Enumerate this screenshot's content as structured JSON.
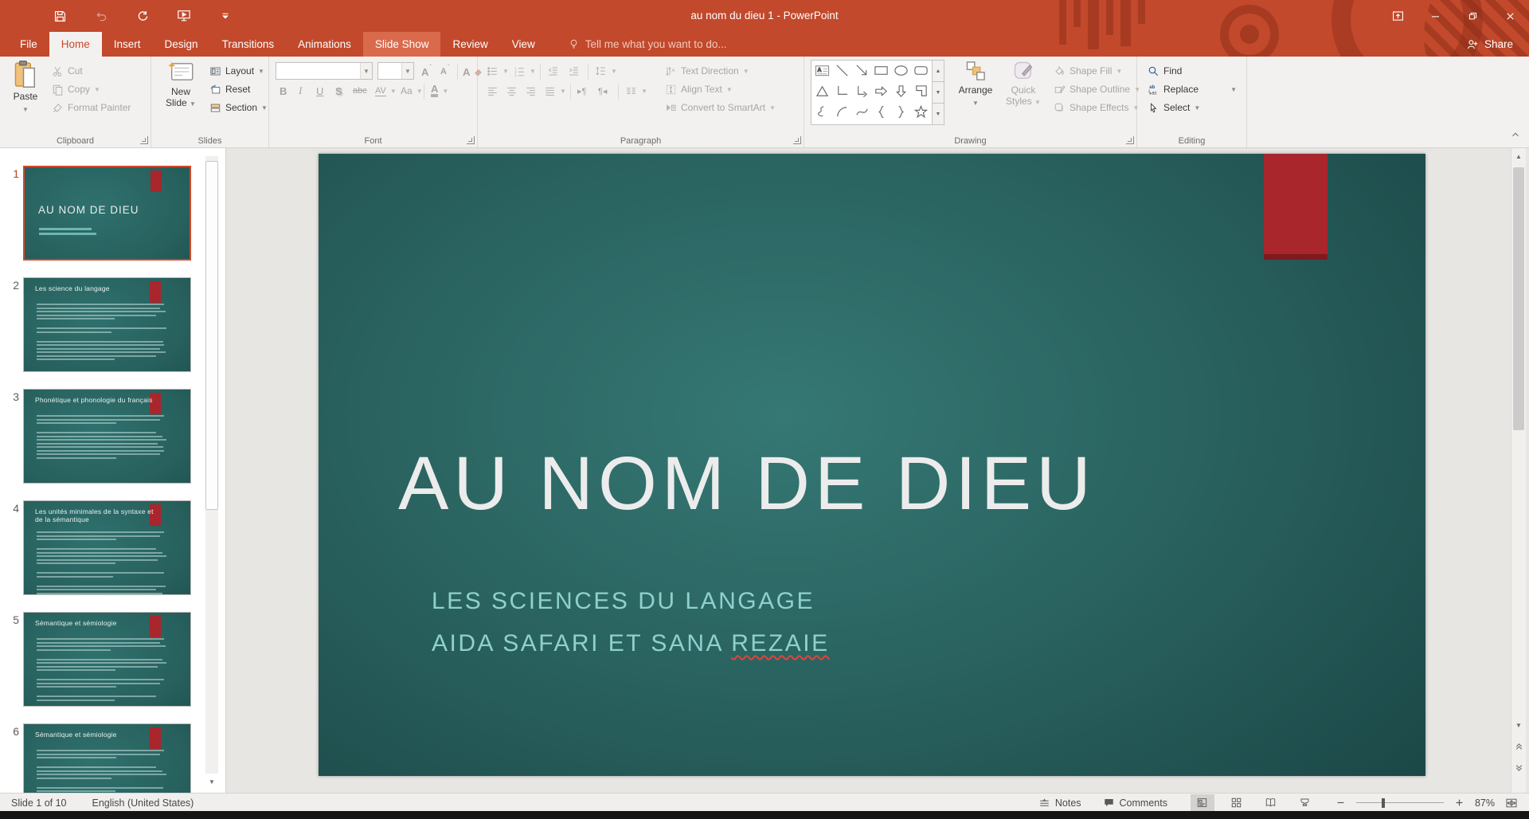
{
  "colors": {
    "accent_red": "#C2492C",
    "tab_highlight": "#D96A4C",
    "slide_teal_center": "#357874",
    "slide_teal_edge": "#153E3E",
    "slide_accent_red": "#A8262C",
    "subtitle_teal": "#8ED1CD"
  },
  "titlebar": {
    "title": "au nom du dieu 1 - PowerPoint"
  },
  "tabs": [
    {
      "label": "File",
      "state": "file"
    },
    {
      "label": "Home",
      "state": "sel"
    },
    {
      "label": "Insert",
      "state": ""
    },
    {
      "label": "Design",
      "state": ""
    },
    {
      "label": "Transitions",
      "state": ""
    },
    {
      "label": "Animations",
      "state": ""
    },
    {
      "label": "Slide Show",
      "state": "hl"
    },
    {
      "label": "Review",
      "state": ""
    },
    {
      "label": "View",
      "state": ""
    }
  ],
  "tellme": {
    "label": "Tell me what you want to do..."
  },
  "share": {
    "label": "Share"
  },
  "ribbon": {
    "clipboard": {
      "label": "Clipboard",
      "paste": "Paste",
      "cut": "Cut",
      "copy": "Copy",
      "format_painter": "Format Painter"
    },
    "slides": {
      "label": "Slides",
      "new_slide_line1": "New",
      "new_slide_line2": "Slide",
      "layout": "Layout",
      "reset": "Reset",
      "section": "Section"
    },
    "font": {
      "label": "Font",
      "bold": "B",
      "italic": "I",
      "underline": "U",
      "shadow": "S",
      "strike": "abc",
      "spacing": "AV",
      "case": "Aa",
      "color": "A",
      "grow": "A",
      "shrink": "A",
      "clear": "A"
    },
    "paragraph": {
      "label": "Paragraph",
      "text_direction": "Text Direction",
      "align_text": "Align Text",
      "convert_smartart": "Convert to SmartArt"
    },
    "drawing": {
      "label": "Drawing",
      "arrange": "Arrange",
      "quick_line1": "Quick",
      "quick_line2": "Styles",
      "shape_fill": "Shape Fill",
      "shape_outline": "Shape Outline",
      "shape_effects": "Shape Effects"
    },
    "editing": {
      "label": "Editing",
      "find": "Find",
      "replace": "Replace",
      "select": "Select"
    }
  },
  "shape_gallery": [
    "textbox",
    "line",
    "arrow",
    "rect",
    "oval",
    "roundrect",
    "triangle",
    "elbow",
    "elbowarrow",
    "arrowright",
    "arrowdown",
    "corner",
    "scribble",
    "arc",
    "curve",
    "braceleft",
    "braceright",
    "star"
  ],
  "thumbnails": [
    {
      "number": "1",
      "type": "title",
      "title": "AU NOM DE DIEU",
      "selected": true,
      "sub_lines": [
        66,
        72
      ],
      "blocks": []
    },
    {
      "number": "2",
      "type": "content",
      "title": "Les science du langage",
      "selected": false,
      "blocks": [
        5,
        2,
        6
      ]
    },
    {
      "number": "3",
      "type": "content",
      "title": "Phonétique et phonologie du français",
      "selected": false,
      "blocks": [
        3,
        8
      ]
    },
    {
      "number": "4",
      "type": "content",
      "title": "Les unités minimales de la syntaxe et de la sémantique",
      "selected": false,
      "blocks": [
        3,
        5,
        2,
        4
      ]
    },
    {
      "number": "5",
      "type": "content",
      "title": "Sémantique et sémiologie",
      "selected": false,
      "blocks": [
        4,
        4,
        3,
        2,
        2
      ]
    },
    {
      "number": "6",
      "type": "content",
      "title": "Sémantique et sémiologie",
      "selected": false,
      "blocks": [
        3,
        4,
        2,
        2
      ]
    }
  ],
  "slide": {
    "title": "AU NOM DE DIEU",
    "subtitle_line1": "LES SCIENCES DU LANGAGE",
    "subtitle_line2_prefix": "AIDA SAFARI ET SANA ",
    "subtitle_line2_misspelled": "REZAIE"
  },
  "statusbar": {
    "slide_info": "Slide 1 of 10",
    "language": "English (United States)",
    "notes": "Notes",
    "comments": "Comments",
    "zoom_level": "87%"
  }
}
